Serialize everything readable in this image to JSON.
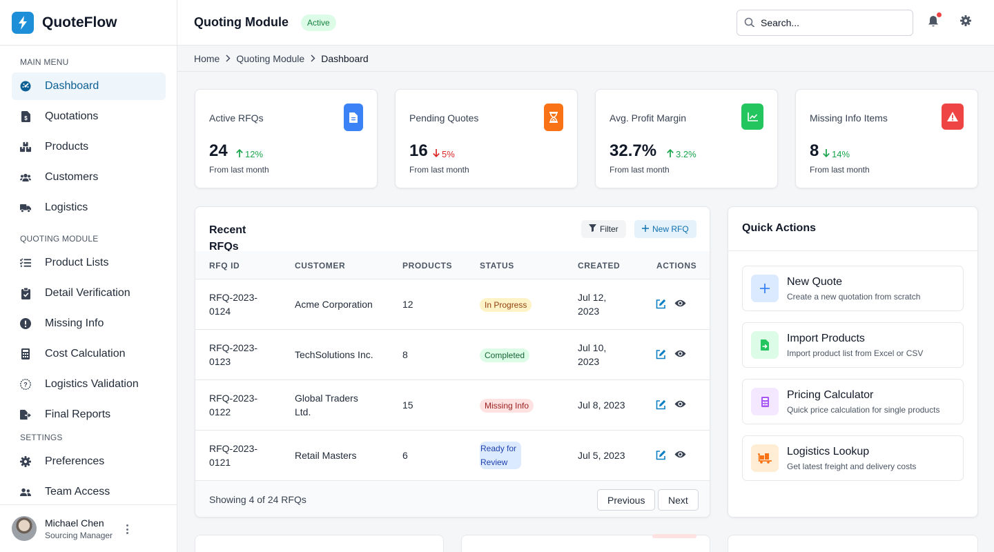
{
  "app": {
    "name": "QuoteFlow"
  },
  "sidebar": {
    "sections": [
      {
        "title": "MAIN MENU"
      },
      {
        "title": "QUOTING MODULE"
      },
      {
        "title": "SETTINGS"
      }
    ],
    "items": [
      {
        "label": "Dashboard",
        "icon": "dashboard-gauge-icon"
      },
      {
        "label": "Quotations",
        "icon": "file-invoice-icon"
      },
      {
        "label": "Products",
        "icon": "boxes-icon"
      },
      {
        "label": "Customers",
        "icon": "users-icon"
      },
      {
        "label": "Logistics",
        "icon": "truck-icon"
      },
      {
        "label": "Product Lists",
        "icon": "list-check-icon"
      },
      {
        "label": "Detail Verification",
        "icon": "clipboard-check-icon"
      },
      {
        "label": "Missing Info",
        "icon": "exclamation-circle-icon"
      },
      {
        "label": "Cost Calculation",
        "icon": "calculator-icon"
      },
      {
        "label": "Logistics Validation",
        "icon": "question-circle-icon"
      },
      {
        "label": "Final Reports",
        "icon": "file-export-icon"
      },
      {
        "label": "Preferences",
        "icon": "gear-icon"
      },
      {
        "label": "Team Access",
        "icon": "users-cog-icon"
      }
    ],
    "active_item": "Dashboard",
    "user": {
      "name": "Michael Chen",
      "role": "Sourcing Manager"
    }
  },
  "header": {
    "title": "Quoting Module",
    "status": "Active",
    "search": {
      "placeholder": "Search...",
      "value": ""
    }
  },
  "breadcrumb": [
    "Home",
    "Quoting Module",
    "Dashboard"
  ],
  "stats": [
    {
      "label": "Active RFQs",
      "value": "24",
      "delta": "12%",
      "direction": "up",
      "sub": "From last month",
      "icon": "document-icon",
      "color": "#3b82f6"
    },
    {
      "label": "Pending Quotes",
      "value": "16",
      "delta": "5%",
      "direction": "down",
      "sub": "From last month",
      "icon": "hourglass-icon",
      "color": "#f97316"
    },
    {
      "label": "Avg. Profit Margin",
      "value": "32.7%",
      "delta": "3.2%",
      "direction": "up",
      "sub": "From last month",
      "icon": "line-chart-icon",
      "color": "#22c55e"
    },
    {
      "label": "Missing Info Items",
      "value": "8",
      "delta": "14%",
      "direction": "down",
      "sub": "From last month",
      "icon": "warning-triangle-icon",
      "color": "#ef4444"
    }
  ],
  "rfq_table": {
    "title": "Recent RFQs",
    "filter_label": "Filter",
    "new_label": "New RFQ",
    "columns": [
      "RFQ ID",
      "CUSTOMER",
      "PRODUCTS",
      "STATUS",
      "CREATED",
      "ACTIONS"
    ],
    "rows": [
      {
        "id_l1": "RFQ-2023-",
        "id_l2": "0124",
        "customer_l1": "Acme Corporation",
        "customer_l2": "",
        "products": "12",
        "status": "In Progress",
        "status_key": "in-progress",
        "created_l1": "Jul 12,",
        "created_l2": "2023"
      },
      {
        "id_l1": "RFQ-2023-",
        "id_l2": "0123",
        "customer_l1": "TechSolutions Inc.",
        "customer_l2": "",
        "products": "8",
        "status": "Completed",
        "status_key": "completed",
        "created_l1": "Jul 10,",
        "created_l2": "2023"
      },
      {
        "id_l1": "RFQ-2023-",
        "id_l2": "0122",
        "customer_l1": "Global Traders",
        "customer_l2": "Ltd.",
        "products": "15",
        "status": "Missing Info",
        "status_key": "missing",
        "created_l1": "Jul 8, 2023",
        "created_l2": ""
      },
      {
        "id_l1": "RFQ-2023-",
        "id_l2": "0121",
        "customer_l1": "Retail Masters",
        "customer_l2": "",
        "products": "6",
        "status": "Ready for Review",
        "status_key": "review",
        "created_l1": "Jul 5, 2023",
        "created_l2": ""
      }
    ],
    "footer_text": "Showing 4 of 24 RFQs",
    "prev_label": "Previous",
    "next_label": "Next"
  },
  "quick_actions": {
    "title": "Quick Actions",
    "items": [
      {
        "title": "New Quote",
        "desc": "Create a new quotation from scratch",
        "icon": "plus-icon",
        "color": "#3b82f6"
      },
      {
        "title": "Import Products",
        "desc": "Import product list from Excel or CSV",
        "icon": "file-import-icon",
        "color": "#22c55e"
      },
      {
        "title": "Pricing Calculator",
        "desc": "Quick price calculation for single products",
        "icon": "calculator-icon",
        "color": "#a855f7"
      },
      {
        "title": "Logistics Lookup",
        "desc": "Get latest freight and delivery costs",
        "icon": "truck-loading-icon",
        "color": "#f97316"
      }
    ]
  }
}
